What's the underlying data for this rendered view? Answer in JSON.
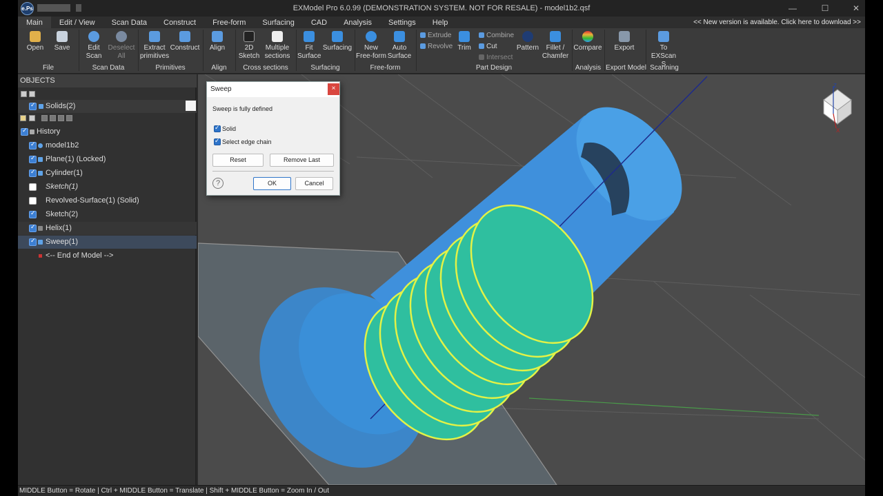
{
  "app": {
    "title": "EXModel Pro 6.0.99 (DEMONSTRATION SYSTEM. NOT FOR RESALE) - model1b2.qsf",
    "logo_text": "e.Ps",
    "new_version": "<< New version is available. Click here to download >>"
  },
  "menu": [
    "Main",
    "Edit / View",
    "Scan Data",
    "Construct",
    "Free-form",
    "Surfacing",
    "CAD",
    "Analysis",
    "Settings",
    "Help"
  ],
  "ribbon": {
    "open": "Open",
    "save": "Save",
    "edit_scan": "Edit Scan",
    "deselect_all": "Deselect All",
    "extract_primitives": "Extract primitives",
    "construct": "Construct",
    "align": "Align",
    "sketch2d": "2D Sketch",
    "multiple_sections": "Multiple sections",
    "fit_surface": "Fit Surface",
    "surfacing": "Surfacing",
    "new_freeform": "New Free-form",
    "auto_surface": "Auto Surface",
    "extrude": "Extrude",
    "revolve": "Revolve",
    "trim": "Trim",
    "combine": "Combine",
    "cut": "Cut",
    "intersect": "Intersect",
    "pattern": "Pattern",
    "fillet": "Fillet / Chamfer",
    "compare": "Compare",
    "export": "Export",
    "to_exscan": "To EXScan S",
    "groups": [
      "File",
      "Scan Data",
      "Primitives",
      "Align",
      "Cross sections",
      "Surfacing",
      "Free-form",
      "Part Design",
      "Analysis",
      "Export Model",
      "Scanning"
    ]
  },
  "objects": {
    "header": "OBJECTS",
    "solids": "Solids(2)",
    "history_label": "History",
    "items": [
      "model1b2",
      "Plane(1) (Locked)",
      "Cylinder(1)",
      "Sketch(1)",
      "Revolved-Surface(1) (Solid)",
      "Sketch(2)",
      "Helix(1)",
      "Sweep(1)",
      "<-- End of Model -->"
    ]
  },
  "dialog": {
    "title": "Sweep",
    "close": "×",
    "status": "Sweep is fully defined",
    "solid": "Solid",
    "select_edge_chain": "Select edge chain",
    "reset": "Reset",
    "remove_last": "Remove Last",
    "help": "?",
    "ok": "OK",
    "cancel": "Cancel"
  },
  "viewcube": {
    "z": "Z",
    "x": "X"
  },
  "status": "MIDDLE Button = Rotate | Ctrl + MIDDLE Button = Translate | Shift + MIDDLE Button = Zoom In / Out"
}
